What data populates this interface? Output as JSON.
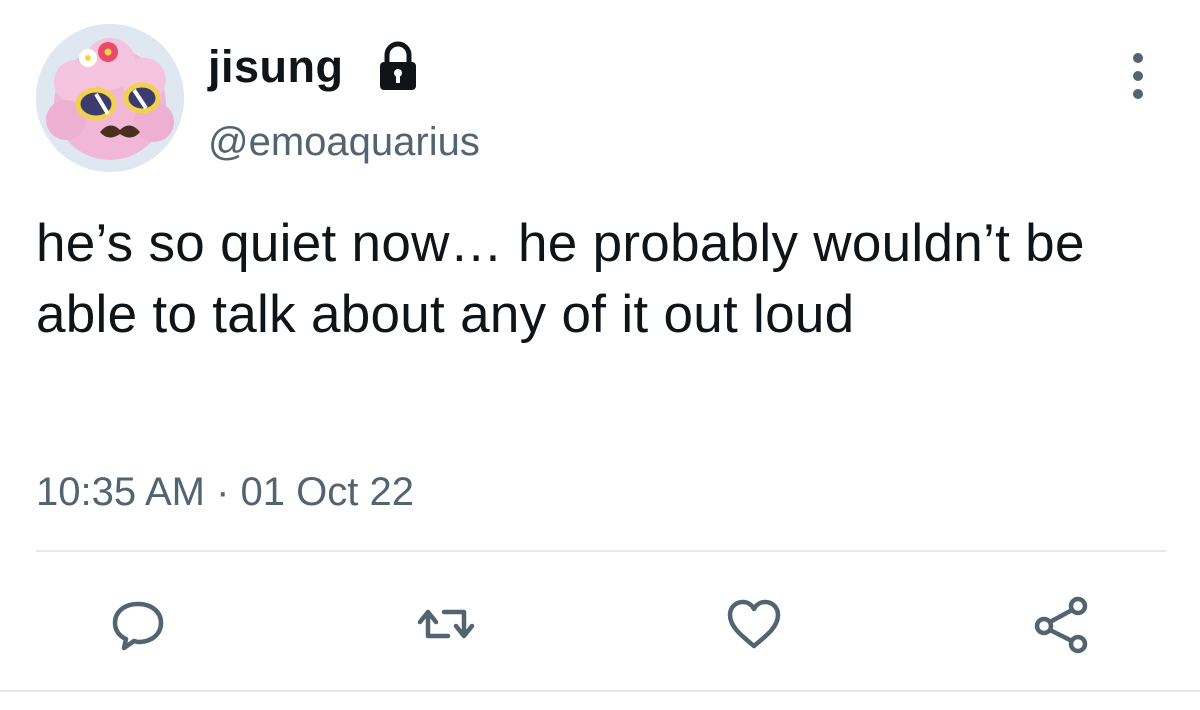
{
  "author": {
    "display_name": "jisung",
    "handle": "@emoaquarius",
    "protected_icon": "lock-icon",
    "avatar": "avatar-image"
  },
  "tweet": {
    "text": "he’s so quiet now… he probably wouldn’t be able to talk about any of it out loud",
    "timestamp": "10:35 AM · 01 Oct 22"
  },
  "actions": [
    {
      "name": "reply",
      "icon": "reply-icon"
    },
    {
      "name": "retweet",
      "icon": "retweet-icon"
    },
    {
      "name": "like",
      "icon": "heart-icon"
    },
    {
      "name": "share",
      "icon": "share-icon"
    }
  ],
  "menu": {
    "icon": "more-vertical-icon"
  },
  "colors": {
    "text": "#0f1419",
    "secondary": "#536471",
    "divider": "#e6e9ec",
    "background": "#ffffff"
  }
}
